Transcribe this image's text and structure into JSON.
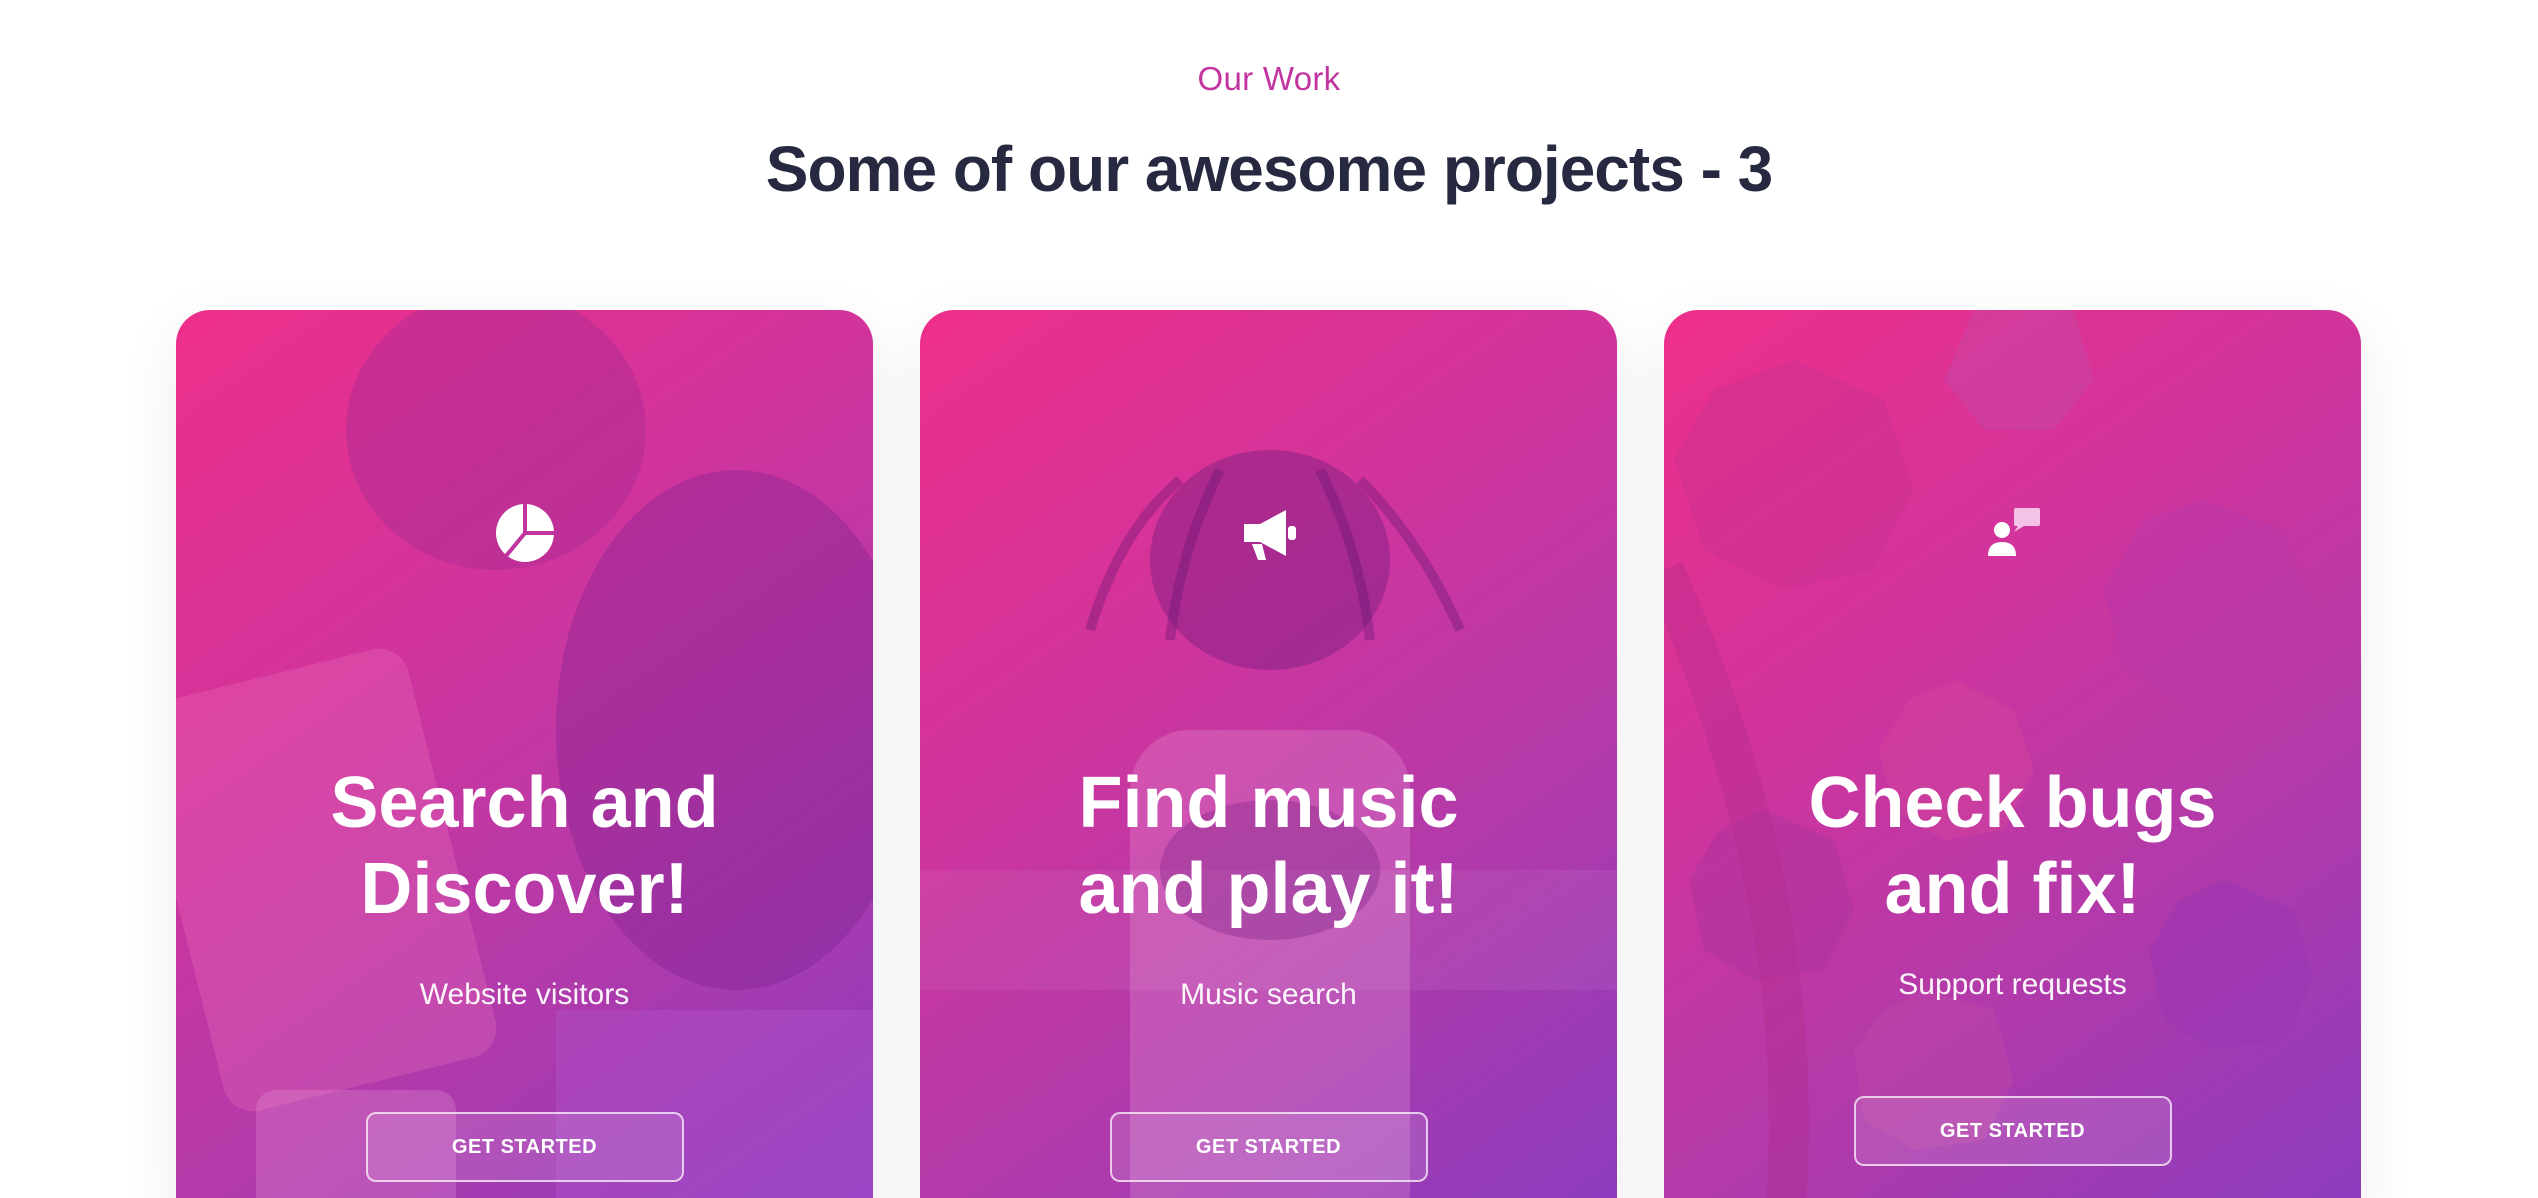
{
  "section": {
    "eyebrow": "Our Work",
    "title": "Some of our awesome projects - 3"
  },
  "cards": [
    {
      "icon": "pie-chart-icon",
      "heading_line1": "Search and",
      "heading_line2": "Discover!",
      "subtitle": "Website visitors",
      "button_label": "GET STARTED"
    },
    {
      "icon": "megaphone-icon",
      "heading_line1": "Find music",
      "heading_line2": "and play it!",
      "subtitle": "Music search",
      "button_label": "GET STARTED"
    },
    {
      "icon": "user-chat-icon",
      "heading_line1": "Check bugs",
      "heading_line2": "and fix!",
      "subtitle": "Support requests",
      "button_label": "GET STARTED"
    }
  ],
  "colors": {
    "accent": "#c2349f",
    "title": "#26293f",
    "gradient_start": "#ee2f8a",
    "gradient_end": "#8a3cbf"
  }
}
